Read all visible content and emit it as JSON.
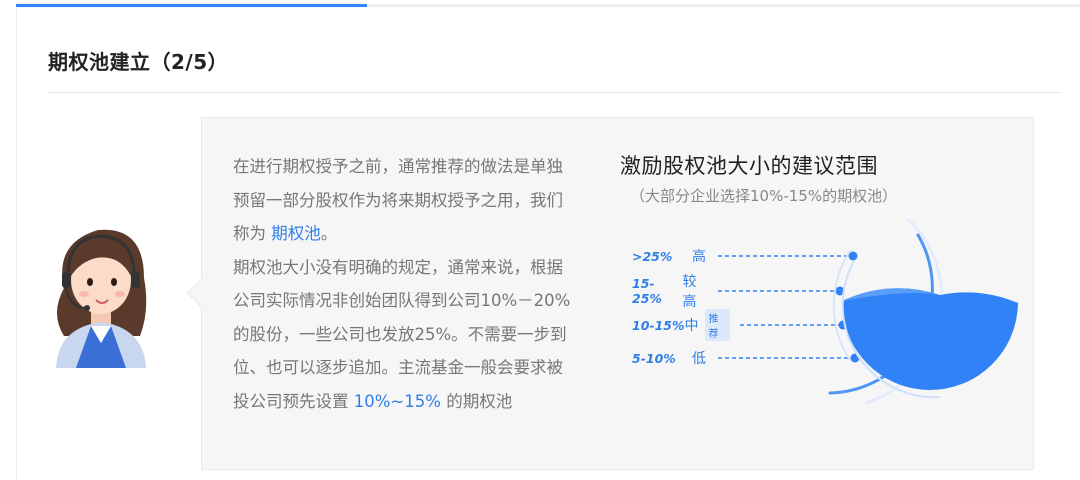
{
  "progress": {
    "fraction": 0.33
  },
  "section": {
    "title": "期权池建立（2/5）"
  },
  "description": {
    "p1_pre": "在进行期权授予之前，通常推荐的做法是单独预留一部分股权作为将来期权授予之用，我们称为",
    "p1_hl": "期权池",
    "p1_post": "。",
    "p2": "期权池大小没有明确的规定，通常来说，根据公司实际情况非创始团队得到公司10%－20%的股份，一些公司也发放25%。不需要一步到位、也可以逐步追加。主流基金一般会要求被投公司预先设置",
    "p2_hl": "10%~15%",
    "p2_post": "的期权池"
  },
  "pool": {
    "title": "激励股权池大小的建议范围",
    "subtitle": "（大部分企业选择10%-15%的期权池）",
    "levels": [
      {
        "range": ">25%",
        "name": "高",
        "tag": ""
      },
      {
        "range": "15-25%",
        "name": "较高",
        "tag": ""
      },
      {
        "range": "10-15%",
        "name": "中",
        "tag": "推荐"
      },
      {
        "range": "5-10%",
        "name": "低",
        "tag": ""
      }
    ]
  },
  "colors": {
    "accent": "#2f86f6",
    "text": "#777777",
    "title": "#222222",
    "panel": "#f6f6f6"
  },
  "icons": {
    "avatar": "customer-service-avatar-icon"
  }
}
